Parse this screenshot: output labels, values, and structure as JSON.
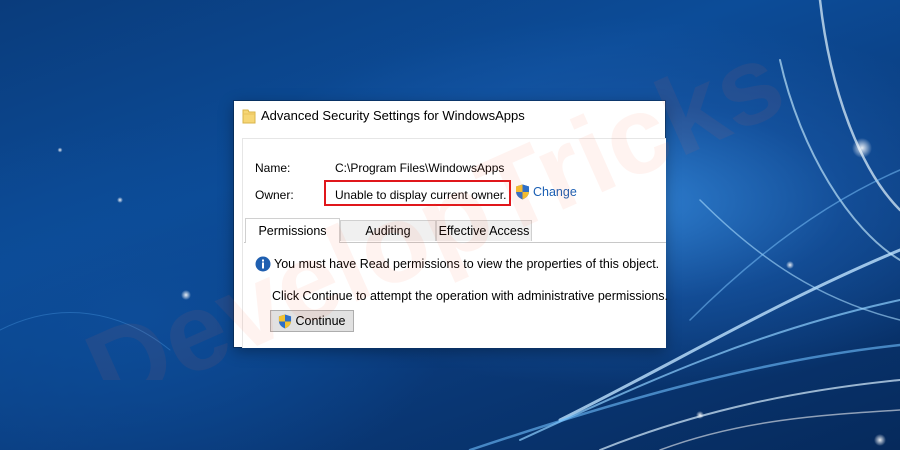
{
  "window": {
    "title": "Advanced Security Settings for WindowsApps"
  },
  "properties": {
    "name_label": "Name:",
    "name_value": "C:\\Program Files\\WindowsApps",
    "owner_label": "Owner:",
    "owner_value": "Unable to display current owner.",
    "change_link": "Change"
  },
  "tabs": [
    {
      "label": "Permissions",
      "active": true
    },
    {
      "label": "Auditing",
      "active": false
    },
    {
      "label": "Effective Access",
      "active": false
    }
  ],
  "permissions_panel": {
    "info_message": "You must have Read permissions to view the properties of this object.",
    "continue_prompt": "Click Continue to attempt the operation with administrative permissions.",
    "continue_button": "Continue"
  },
  "watermark": {
    "text": "DevelopTricks"
  },
  "colors": {
    "highlight_border": "#e0161b",
    "link": "#1a5fb4",
    "info_icon": "#1f5fb0",
    "wallpaper": "#0a3c7c"
  },
  "icons": {
    "title": "folder-icon",
    "change": "uac-shield-icon",
    "info": "info-icon",
    "button": "uac-shield-icon"
  }
}
